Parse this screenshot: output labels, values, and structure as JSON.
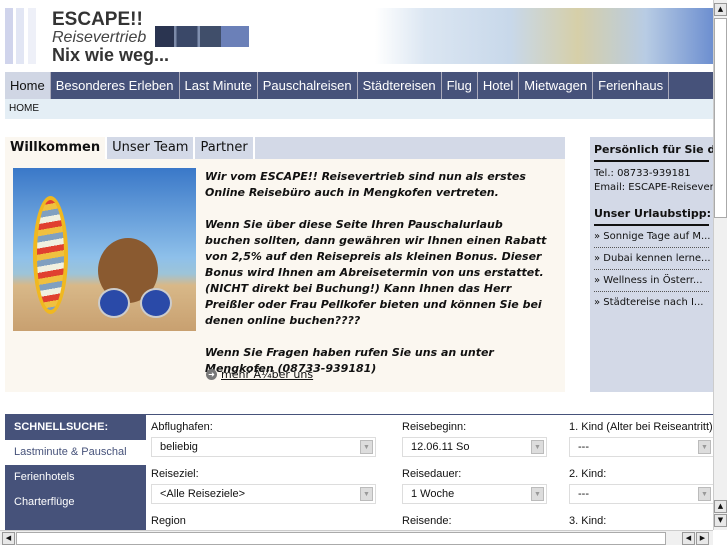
{
  "header": {
    "logo_line1": "ESCAPE!!",
    "logo_line2": "Reisevertrieb",
    "logo_line3": "Nix wie weg..."
  },
  "nav": {
    "items": [
      "Home",
      "Besonderes Erleben",
      "Last Minute",
      "Pauschalreisen",
      "Städtereisen",
      "Flug",
      "Hotel",
      "Mietwagen",
      "Ferienhaus"
    ],
    "active": "Home"
  },
  "breadcrumb": "HOME",
  "main": {
    "tabs": [
      "Willkommen",
      "Unser Team",
      "Partner"
    ],
    "paragraphs": [
      "Wir vom ESCAPE!! Reisevertrieb sind nun als erstes Online Reisebüro auch in Mengkofen vertreten.",
      "Wenn Sie über diese Seite Ihren Pauschalurlaub buchen sollten, dann gewähren wir Ihnen einen Rabatt von 2,5% auf den Reisepreis als kleinen Bonus. Dieser Bonus wird Ihnen am Abreisetermin von uns erstattet. (NICHT direkt bei Buchung!) Kann Ihnen das Herr Preißler oder Frau Pellkofer bieten und können Sie bei denen online buchen????",
      "Wenn Sie Fragen haben rufen Sie uns an unter Mengkofen (08733-939181)"
    ],
    "more_link": "mehr Ã¼ber uns"
  },
  "sidebar": {
    "heading1": "Persönlich für Sie da",
    "tel": "Tel.: 08733-939181",
    "email": "Email: ESCAPE-Reisevertrieb",
    "heading2": "Unser Urlaubstipp:",
    "tips": [
      "» Sonnige Tage auf M...",
      "» Dubai kennen lerne...",
      "» Wellness in Österr...",
      "» Städtereise nach I..."
    ]
  },
  "search": {
    "title": "SCHNELLSUCHE:",
    "nav": [
      "Lastminute & Pauschal",
      "Ferienhotels",
      "Charterflüge"
    ],
    "fields": {
      "abflughafen_label": "Abflughafen:",
      "abflughafen_value": "beliebig",
      "reisebeginn_label": "Reisebeginn:",
      "reisebeginn_value": "12.06.11 So",
      "kind1_label": "1. Kind (Alter bei Reiseantritt)",
      "kind1_value": "---",
      "reiseziel_label": "Reiseziel:",
      "reiseziel_value": "<Alle Reiseziele>",
      "reisedauer_label": "Reisedauer:",
      "reisedauer_value": "1 Woche",
      "kind2_label": "2. Kind:",
      "kind2_value": "---",
      "region_label": "Region",
      "reisende_label": "Reisende:",
      "kind3_label": "3. Kind:"
    }
  },
  "colors": {
    "nav_bg": "#46527a",
    "panel_bg": "#d3d9e7",
    "content_bg": "#fbf7f0"
  }
}
